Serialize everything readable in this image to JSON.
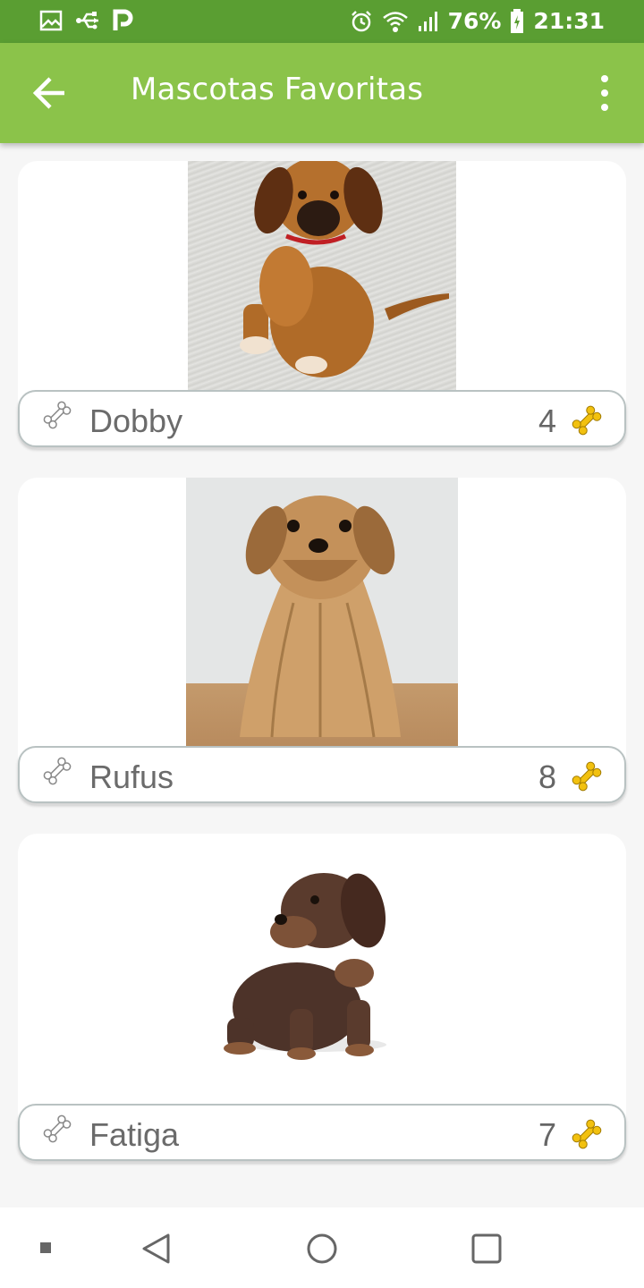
{
  "status_bar": {
    "battery": "76%",
    "time": "21:31",
    "icons": [
      "image-icon",
      "usb-icon",
      "parking-icon",
      "alarm-icon",
      "wifi-icon",
      "signal-icon",
      "battery-icon"
    ]
  },
  "app_bar": {
    "title": "Mascotas Favoritas",
    "back_icon": "arrow-back-icon",
    "menu_icon": "more-vert-icon"
  },
  "pets": [
    {
      "name": "Dobby",
      "likes": "4",
      "photo": "brown-puppy-on-carpet"
    },
    {
      "name": "Rufus",
      "likes": "8",
      "photo": "yorkshire-terrier"
    },
    {
      "name": "Fatiga",
      "likes": "7",
      "photo": "dachshund-puppy"
    }
  ],
  "colors": {
    "status_bar": "#5a9e32",
    "app_bar": "#8bc34a",
    "bone_filled": "#f2c10f"
  },
  "nav_bar": {
    "buttons": [
      "back-triangle-icon",
      "home-circle-icon",
      "recents-square-icon"
    ]
  }
}
